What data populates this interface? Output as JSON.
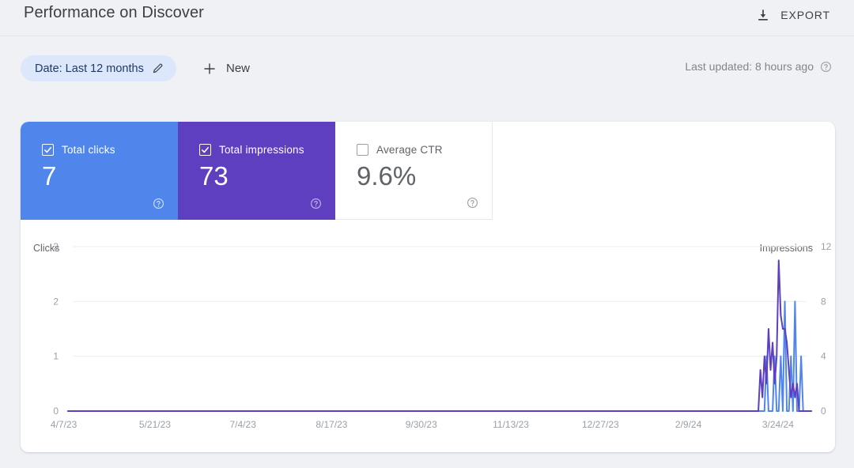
{
  "header": {
    "title": "Performance on Discover",
    "export_label": "EXPORT",
    "export_icon": "download-icon"
  },
  "filters": {
    "date_chip_label": "Date: Last 12 months",
    "date_chip_icon": "pencil-icon",
    "new_label": "New",
    "new_icon": "plus-icon",
    "last_updated": "Last updated: 8 hours ago",
    "help_icon": "question-mark-icon"
  },
  "metrics": [
    {
      "label": "Total clicks",
      "value": "7",
      "checked": true,
      "color": "#5086ec",
      "text_color": "#ffffff"
    },
    {
      "label": "Total impressions",
      "value": "73",
      "checked": true,
      "color": "#5d3fbf",
      "text_color": "#ffffff"
    },
    {
      "label": "Average CTR",
      "value": "9.6%",
      "checked": false,
      "color": "#ffffff",
      "text_color": "#5f6368"
    }
  ],
  "chart_data": {
    "type": "line",
    "title": "Performance on Discover",
    "xlabel": "",
    "ylabel": "Clicks",
    "y2label": "Impressions",
    "grid": true,
    "legend": "none",
    "ylim": [
      0,
      3
    ],
    "y2lim": [
      0,
      12
    ],
    "yticks": [
      0,
      1,
      2,
      3
    ],
    "y2ticks": [
      0,
      4,
      8,
      12
    ],
    "xtick_labels": [
      "4/7/23",
      "5/21/23",
      "7/4/23",
      "8/17/23",
      "9/30/23",
      "11/13/23",
      "12/27/23",
      "2/9/24",
      "3/24/24"
    ],
    "xtick_positions_pct": [
      5.3,
      16.5,
      27.3,
      38.2,
      49.2,
      60.2,
      71.2,
      82.0,
      93.0
    ],
    "x_start": "4/7/23",
    "x_end": "4/7/24",
    "n_points": 366,
    "series": [
      {
        "name": "Clicks",
        "color": "#5086ec",
        "axis": "left",
        "note": "Flat at 0 until late March 2024, then sparse single-day spikes.",
        "spikes": [
          {
            "i": 340,
            "v": 0
          },
          {
            "i": 343,
            "v": 1
          },
          {
            "i": 344,
            "v": 0
          },
          {
            "i": 346,
            "v": 0
          },
          {
            "i": 347,
            "v": 1
          },
          {
            "i": 348,
            "v": 0
          },
          {
            "i": 350,
            "v": 1
          },
          {
            "i": 351,
            "v": 0
          },
          {
            "i": 352,
            "v": 2
          },
          {
            "i": 353,
            "v": 0
          },
          {
            "i": 355,
            "v": 1
          },
          {
            "i": 356,
            "v": 0
          },
          {
            "i": 357,
            "v": 2
          },
          {
            "i": 358,
            "v": 0
          },
          {
            "i": 360,
            "v": 1
          },
          {
            "i": 361,
            "v": 0
          },
          {
            "i": 363,
            "v": 0
          }
        ]
      },
      {
        "name": "Impressions",
        "color": "#5d3fbf",
        "axis": "right",
        "note": "Flat at 0 until late March 2024, then a dense burst peaking at 11.",
        "spikes": [
          {
            "i": 338,
            "v": 0
          },
          {
            "i": 340,
            "v": 3
          },
          {
            "i": 341,
            "v": 1
          },
          {
            "i": 342,
            "v": 4
          },
          {
            "i": 343,
            "v": 2
          },
          {
            "i": 344,
            "v": 6
          },
          {
            "i": 345,
            "v": 3
          },
          {
            "i": 346,
            "v": 5
          },
          {
            "i": 347,
            "v": 2
          },
          {
            "i": 348,
            "v": 4
          },
          {
            "i": 349,
            "v": 11
          },
          {
            "i": 350,
            "v": 7
          },
          {
            "i": 351,
            "v": 6
          },
          {
            "i": 352,
            "v": 6
          },
          {
            "i": 353,
            "v": 5
          },
          {
            "i": 354,
            "v": 3
          },
          {
            "i": 355,
            "v": 1
          },
          {
            "i": 356,
            "v": 2
          },
          {
            "i": 357,
            "v": 1
          },
          {
            "i": 358,
            "v": 2
          },
          {
            "i": 359,
            "v": 0
          }
        ]
      }
    ]
  }
}
